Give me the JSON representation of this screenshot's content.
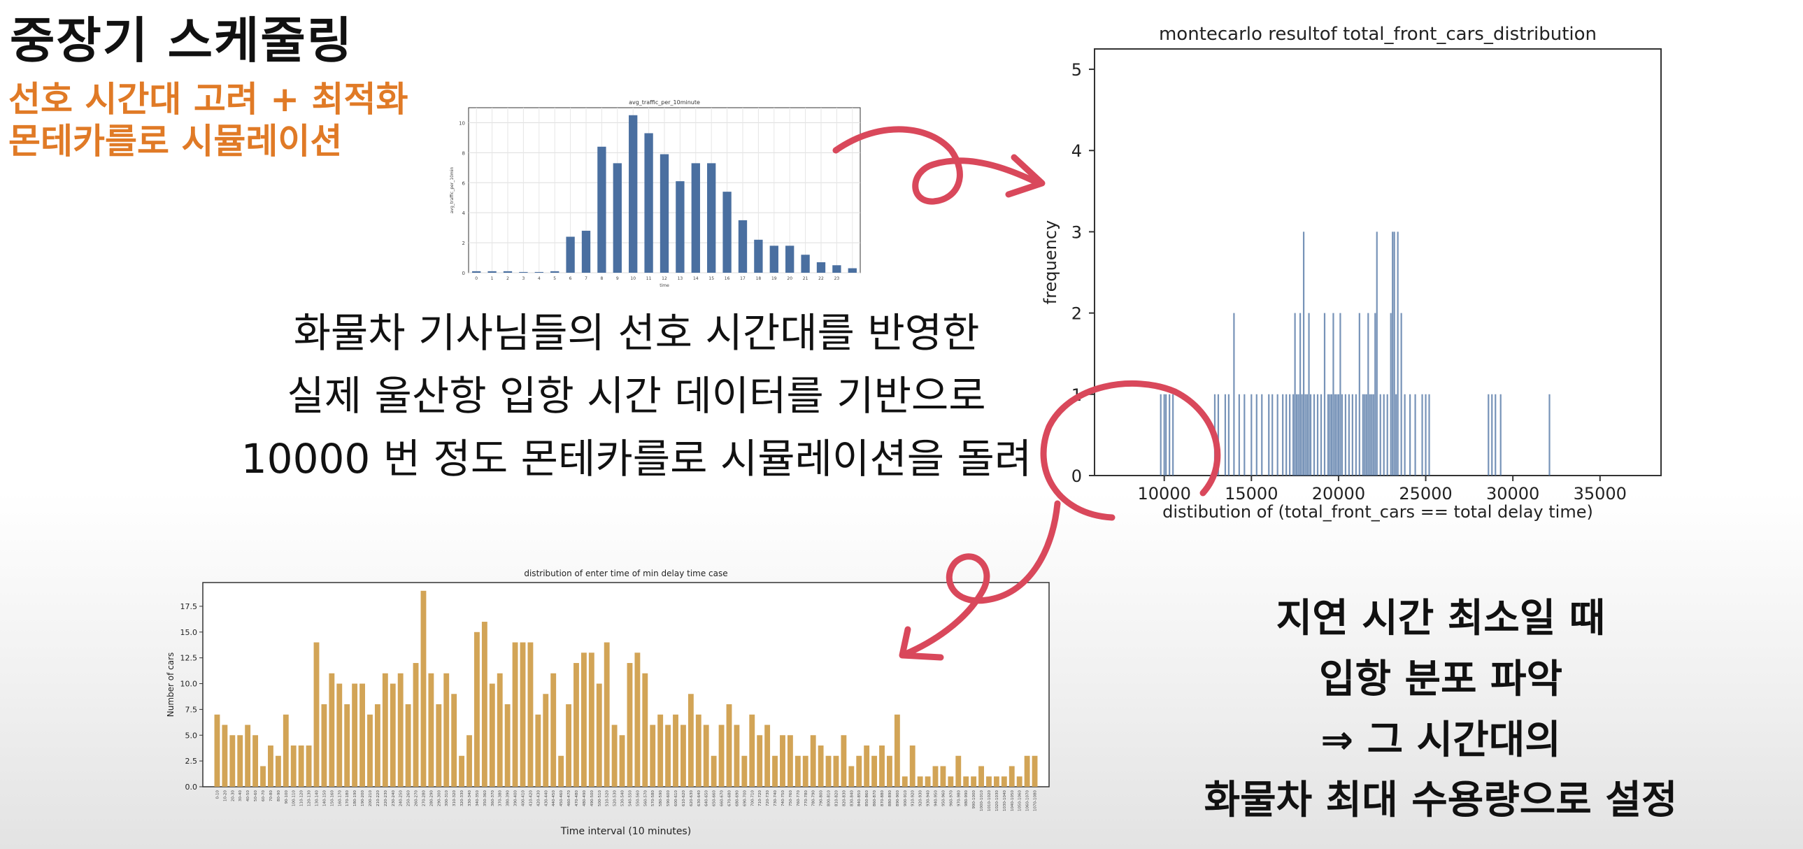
{
  "title": "중장기 스케줄링",
  "subtitle_lines": [
    "선호 시간대 고려 + 최적화",
    "몬테카를로 시뮬레이션"
  ],
  "description_lines": [
    "화물차 기사님들의 선호 시간대를 반영한",
    "실제 울산항 입항 시간 데이터를 기반으로",
    "10000 번 정도 몬테카를로 시뮬레이션을 돌려"
  ],
  "conclusion_lines": [
    "지연 시간 최소일 때",
    "입항 분포 파악",
    "⇒ 그 시간대의",
    "화물차 최대 수용량으로 설정"
  ],
  "colors": {
    "accent": "#e07a26",
    "arrow": "#d9485b",
    "bar_blue": "#4a6fa0",
    "bar_gold": "#d2a456"
  },
  "chart_data": [
    {
      "type": "bar",
      "title": "avg_traffic_per_10minute",
      "xlabel": "time",
      "ylabel": "avg_traffic_per_10min",
      "categories": [
        "0",
        "1",
        "2",
        "3",
        "4",
        "5",
        "6",
        "7",
        "8",
        "9",
        "10",
        "11",
        "12",
        "13",
        "14",
        "15",
        "16",
        "17",
        "18",
        "19",
        "20",
        "21",
        "22",
        "23"
      ],
      "values": [
        0.1,
        0.1,
        0.1,
        0.05,
        0.05,
        0.1,
        2.4,
        2.8,
        8.4,
        7.3,
        10.5,
        9.3,
        7.9,
        6.1,
        7.3,
        7.3,
        5.4,
        3.5,
        2.2,
        1.8,
        1.8,
        1.2,
        0.7,
        0.5,
        0.3
      ],
      "yticks": [
        "0",
        "2",
        "4",
        "6",
        "8",
        "10"
      ],
      "ylim": [
        0,
        11
      ]
    },
    {
      "type": "bar",
      "title": "montecarlo resultof total_front_cars_distribution",
      "xlabel": "distibution of (total_front_cars == total delay time)",
      "ylabel": "frequency",
      "xlim": [
        6000,
        38500
      ],
      "ylim": [
        0,
        5.25
      ],
      "xticks": [
        "10000",
        "15000",
        "20000",
        "25000",
        "30000",
        "35000"
      ],
      "yticks": [
        "0",
        "1",
        "2",
        "3",
        "4",
        "5"
      ],
      "x": [
        9800,
        10000,
        10100,
        10300,
        10500,
        12900,
        13100,
        13500,
        13700,
        14000,
        14300,
        14600,
        15000,
        15300,
        15600,
        16000,
        16200,
        16500,
        16800,
        17000,
        17200,
        17400,
        17500,
        17600,
        17700,
        17800,
        17900,
        18000,
        18100,
        18200,
        18300,
        18400,
        18600,
        18800,
        19000,
        19200,
        19400,
        19500,
        19600,
        19700,
        19800,
        19900,
        20000,
        20100,
        20200,
        20400,
        20600,
        20800,
        21000,
        21200,
        21400,
        21500,
        21600,
        21700,
        21800,
        21900,
        22000,
        22100,
        22200,
        22400,
        22600,
        22800,
        23000,
        23100,
        23200,
        23300,
        23400,
        23600,
        23800,
        24100,
        24400,
        24800,
        25000,
        25200,
        28600,
        28800,
        29000,
        29300,
        32100
      ],
      "values": [
        1,
        1,
        1,
        1,
        1,
        1,
        1,
        1,
        1,
        2,
        1,
        1,
        1,
        1,
        1,
        1,
        1,
        1,
        1,
        1,
        1,
        1,
        2,
        1,
        1,
        2,
        1,
        3,
        1,
        1,
        2,
        1,
        1,
        1,
        1,
        2,
        1,
        1,
        1,
        2,
        1,
        1,
        1,
        2,
        1,
        1,
        1,
        1,
        1,
        2,
        1,
        1,
        1,
        2,
        1,
        1,
        1,
        2,
        3,
        1,
        1,
        1,
        2,
        3,
        3,
        1,
        3,
        2,
        1,
        1,
        1,
        1,
        1,
        1,
        1,
        1,
        1,
        1,
        1
      ]
    },
    {
      "type": "bar",
      "title": "distribution of enter time of min delay time case",
      "xlabel": "Time interval (10 minutes)",
      "ylabel": "Number of cars",
      "ylim": [
        0,
        19.8
      ],
      "yticks": [
        "0.0",
        "2.5",
        "5.0",
        "7.5",
        "10.0",
        "12.5",
        "15.0",
        "17.5"
      ],
      "tick_label_pattern": "start-end (minutes, step 10)",
      "values": [
        7,
        6,
        5,
        5,
        6,
        5,
        2,
        4,
        3,
        7,
        4,
        4,
        4,
        14,
        8,
        11,
        10,
        8,
        10,
        10,
        7,
        8,
        11,
        10,
        11,
        8,
        12,
        19,
        11,
        8,
        11,
        9,
        3,
        5,
        15,
        16,
        10,
        11,
        8,
        14,
        14,
        14,
        7,
        9,
        11,
        3,
        8,
        12,
        13,
        13,
        10,
        14,
        6,
        5,
        12,
        13,
        11,
        6,
        7,
        6,
        7,
        6,
        9,
        7,
        6,
        3,
        6,
        8,
        6,
        3,
        7,
        5,
        6,
        3,
        5,
        5,
        3,
        3,
        5,
        4,
        3,
        3,
        5,
        2,
        3,
        4,
        3,
        4,
        3,
        7,
        1,
        4,
        1,
        1,
        2,
        2,
        1,
        3,
        1,
        1,
        2,
        1,
        1,
        1,
        2,
        1,
        3,
        3
      ]
    }
  ]
}
